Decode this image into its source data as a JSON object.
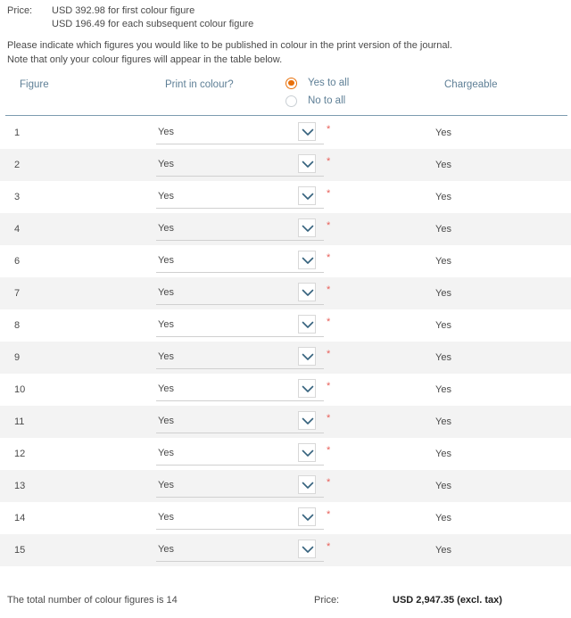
{
  "price_info": {
    "label": "Price:",
    "lines": [
      "USD 392.98 for first colour figure",
      "USD 196.49 for each subsequent colour figure"
    ]
  },
  "instructions": {
    "line1": "Please indicate which figures you would like to be published in colour in the print version of the journal.",
    "line2": "Note that only your colour figures will appear in the table below."
  },
  "table_headers": {
    "figure": "Figure",
    "print_in_colour": "Print in colour?",
    "chargeable": "Chargeable"
  },
  "bulk_radio": {
    "yes_label": "Yes to all",
    "no_label": "No to all",
    "selected": "yes"
  },
  "rows": [
    {
      "figure": "1",
      "print_in_colour": "Yes",
      "chargeable": "Yes",
      "required": "*"
    },
    {
      "figure": "2",
      "print_in_colour": "Yes",
      "chargeable": "Yes",
      "required": "*"
    },
    {
      "figure": "3",
      "print_in_colour": "Yes",
      "chargeable": "Yes",
      "required": "*"
    },
    {
      "figure": "4",
      "print_in_colour": "Yes",
      "chargeable": "Yes",
      "required": "*"
    },
    {
      "figure": "6",
      "print_in_colour": "Yes",
      "chargeable": "Yes",
      "required": "*"
    },
    {
      "figure": "7",
      "print_in_colour": "Yes",
      "chargeable": "Yes",
      "required": "*"
    },
    {
      "figure": "8",
      "print_in_colour": "Yes",
      "chargeable": "Yes",
      "required": "*"
    },
    {
      "figure": "9",
      "print_in_colour": "Yes",
      "chargeable": "Yes",
      "required": "*"
    },
    {
      "figure": "10",
      "print_in_colour": "Yes",
      "chargeable": "Yes",
      "required": "*"
    },
    {
      "figure": "11",
      "print_in_colour": "Yes",
      "chargeable": "Yes",
      "required": "*"
    },
    {
      "figure": "12",
      "print_in_colour": "Yes",
      "chargeable": "Yes",
      "required": "*"
    },
    {
      "figure": "13",
      "print_in_colour": "Yes",
      "chargeable": "Yes",
      "required": "*"
    },
    {
      "figure": "14",
      "print_in_colour": "Yes",
      "chargeable": "Yes",
      "required": "*"
    },
    {
      "figure": "15",
      "print_in_colour": "Yes",
      "chargeable": "Yes",
      "required": "*"
    }
  ],
  "footer": {
    "total_text": "The total number of colour figures is 14",
    "price_label": "Price:",
    "price_value": "USD 2,947.35 (excl. tax)"
  },
  "colors": {
    "header_link": "#5e7f96",
    "radio_accent": "#e8700a",
    "required_star": "#e8605a",
    "divider": "#7d9cb0",
    "row_alt": "#f3f3f3",
    "text": "#4a4a4a"
  }
}
